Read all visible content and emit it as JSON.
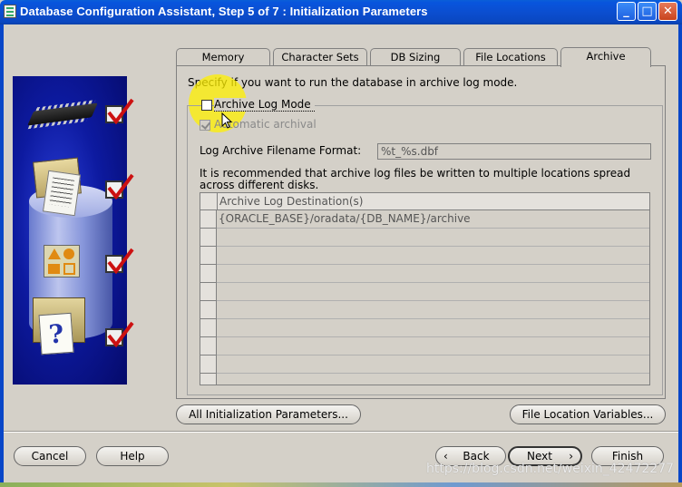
{
  "window": {
    "title": "Database Configuration Assistant, Step 5 of 7 : Initialization Parameters",
    "controls": {
      "minimize": "_",
      "maximize": "□",
      "close": "✕"
    }
  },
  "tabs": [
    {
      "label": "Memory",
      "active": false
    },
    {
      "label": "Character Sets",
      "active": false
    },
    {
      "label": "DB Sizing",
      "active": false
    },
    {
      "label": "File Locations",
      "active": false
    },
    {
      "label": "Archive",
      "active": true
    }
  ],
  "archive": {
    "description": "Specify if you want to run the database in archive log mode.",
    "archive_log_mode_label": "Archive Log Mode",
    "archive_log_mode_checked": false,
    "automatic_archival_label": "Automatic archival",
    "automatic_archival_checked": true,
    "filename_format_label": "Log Archive Filename Format:",
    "filename_format_value": "%t_%s.dbf",
    "recommendation": "It is recommended that archive log files be written to multiple locations spread across different disks.",
    "table": {
      "header": "Archive Log Destination(s)",
      "rows": [
        "{ORACLE_BASE}/oradata/{DB_NAME}/archive",
        "",
        "",
        "",
        "",
        "",
        "",
        "",
        "",
        ""
      ]
    }
  },
  "buttons": {
    "all_init_params": "All Initialization Parameters...",
    "file_location_vars": "File Location Variables...",
    "cancel": "Cancel",
    "help": "Help",
    "back": "Back",
    "next": "Next",
    "finish": "Finish"
  },
  "watermark": "https://blog.csdn.net/weixin_42472277",
  "colors": {
    "title_bar": "#0a4fd0",
    "dialog_bg": "#d4d0c8",
    "highlight": "#fff000",
    "check_red": "#cc1111"
  }
}
